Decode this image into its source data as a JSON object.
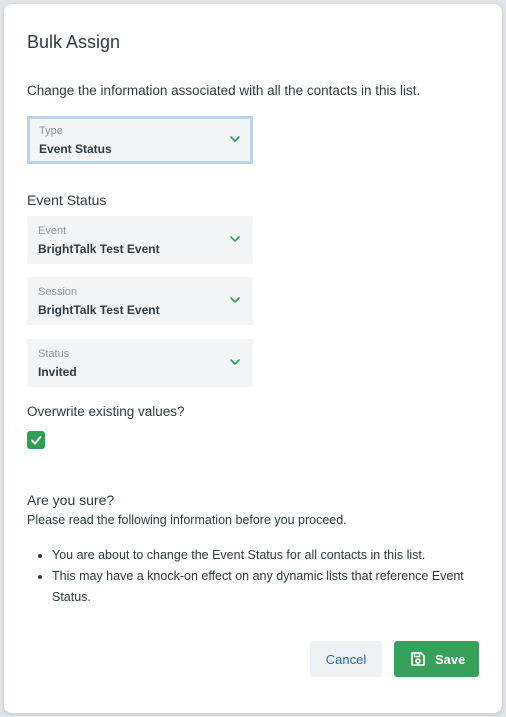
{
  "modal": {
    "title": "Bulk Assign",
    "intro": "Change the information associated with all the contacts in this list."
  },
  "type_select": {
    "label": "Type",
    "value": "Event Status"
  },
  "section": {
    "label": "Event Status"
  },
  "event_select": {
    "label": "Event",
    "value": "BrightTalk Test Event"
  },
  "session_select": {
    "label": "Session",
    "value": "BrightTalk Test Event"
  },
  "status_select": {
    "label": "Status",
    "value": "Invited"
  },
  "overwrite": {
    "label": "Overwrite existing values?",
    "checked": true
  },
  "confirm": {
    "heading": "Are you sure?",
    "subheading": "Please read the following information before you proceed.",
    "bullets": [
      "You are about to change the Event Status for all contacts in this list.",
      "This may have a knock-on effect on any dynamic lists that reference Event Status."
    ]
  },
  "buttons": {
    "cancel": "Cancel",
    "save": "Save"
  },
  "icons": {
    "chevron": "chevron-down-icon",
    "check": "check-icon",
    "save": "floppy-disk-icon"
  },
  "colors": {
    "primary_green": "#37a05a",
    "link_blue": "#2b6cb0",
    "focus_ring": "#b8d1f0"
  }
}
